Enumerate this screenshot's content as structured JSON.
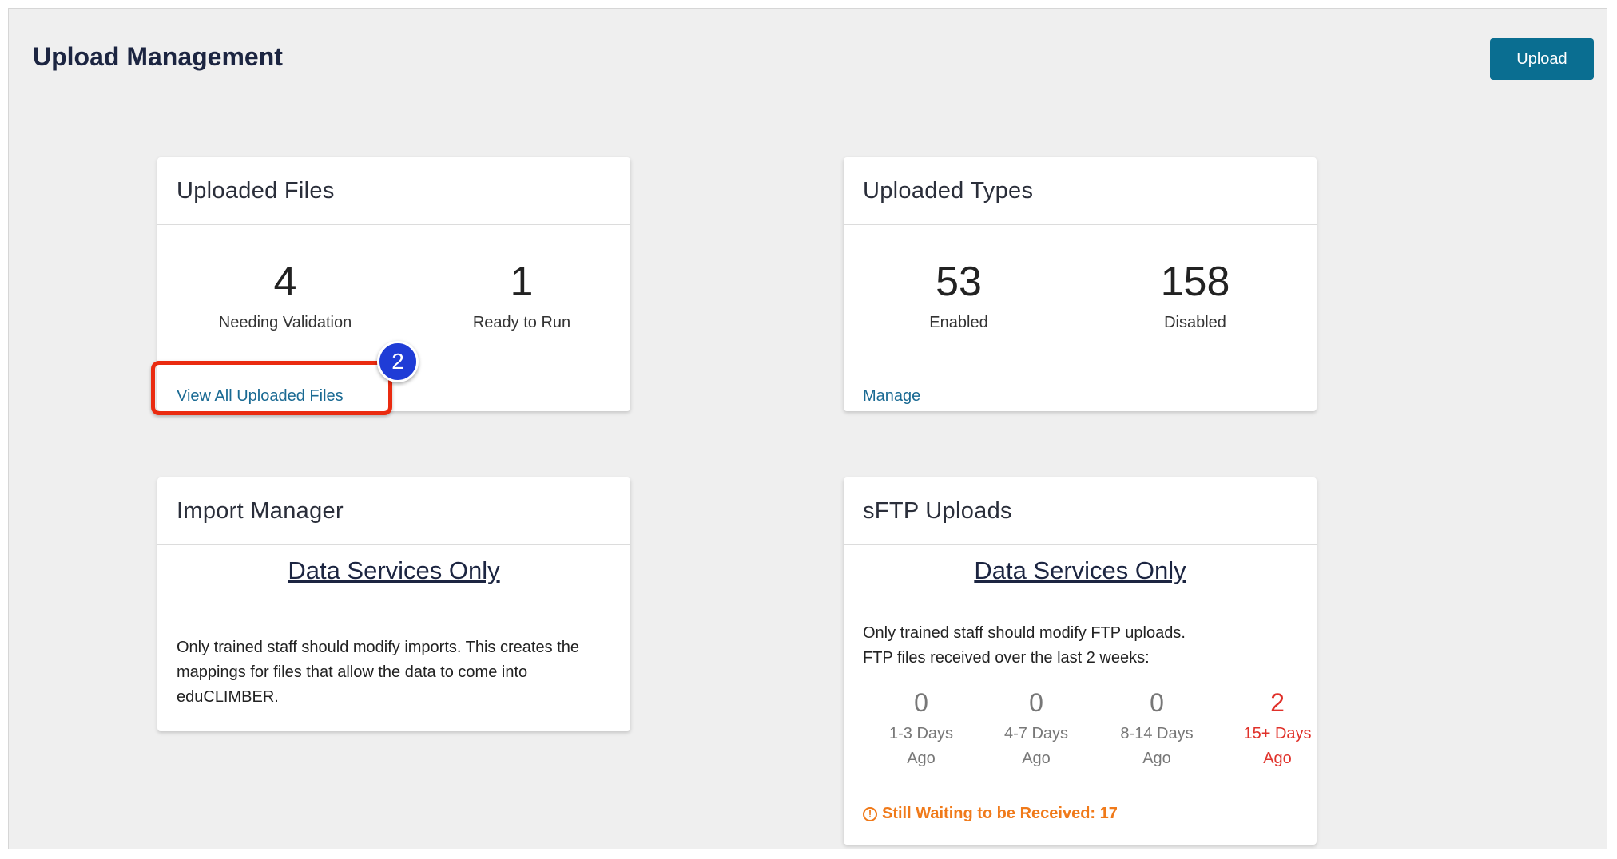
{
  "header": {
    "title": "Upload Management",
    "upload_label": "Upload"
  },
  "uploaded_files": {
    "title": "Uploaded Files",
    "stats": [
      {
        "value": "4",
        "label": "Needing Validation"
      },
      {
        "value": "1",
        "label": "Ready to Run"
      }
    ],
    "link": "View All Uploaded Files"
  },
  "uploaded_types": {
    "title": "Uploaded Types",
    "stats": [
      {
        "value": "53",
        "label": "Enabled"
      },
      {
        "value": "158",
        "label": "Disabled"
      }
    ],
    "link": "Manage"
  },
  "import_manager": {
    "title": "Import Manager",
    "subtitle": "Data Services Only",
    "text_lines": [
      "Only trained staff should modify imports. This creates the",
      "mappings for files that allow the data to come into",
      "eduCLIMBER."
    ]
  },
  "sftp_uploads": {
    "title": "sFTP Uploads",
    "subtitle": "Data Services Only",
    "text_lines": [
      "Only trained staff should modify FTP uploads.",
      "FTP files received over the last 2 weeks:"
    ],
    "stats": [
      {
        "value": "0",
        "label_lines": [
          "1-3 Days",
          "Ago"
        ]
      },
      {
        "value": "0",
        "label_lines": [
          "4-7 Days",
          "Ago"
        ]
      },
      {
        "value": "0",
        "label_lines": [
          "8-14 Days",
          "Ago"
        ]
      },
      {
        "value": "2",
        "label_lines": [
          "15+ Days",
          "Ago"
        ]
      }
    ],
    "waiting": "Still Waiting to be Received: 17"
  },
  "annotation": {
    "step": "2"
  },
  "colors": {
    "accent": "#0a6e91",
    "link": "#1a6a93",
    "alert": "#e0312a",
    "warning": "#f07a1a",
    "highlight": "#ea2b10",
    "badge": "#1f3cd6"
  }
}
